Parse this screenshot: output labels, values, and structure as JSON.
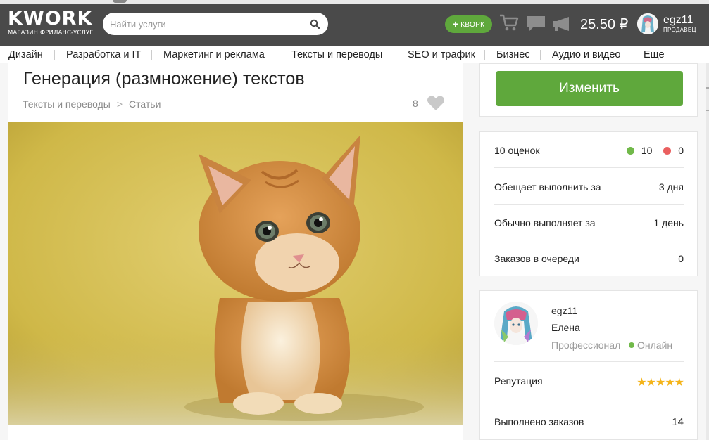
{
  "header": {
    "logo_word": "KWORK",
    "logo_tagline": "МАГАЗИН ФРИЛАНС-УСЛУГ",
    "search_placeholder": "Найти услуги",
    "add_button": "КВОРК",
    "balance": "25.50 ₽",
    "username": "egz11",
    "user_role": "ПРОДАВЕЦ",
    "accent_color": "#5fa83c"
  },
  "nav": {
    "items": [
      "Дизайн",
      "Разработка и IT",
      "Маркетинг и реклама",
      "Тексты и переводы",
      "SEO и трафик",
      "Бизнес",
      "Аудио и видео",
      "Еще"
    ]
  },
  "kwork": {
    "title": "Генерация (размножение) текстов",
    "breadcrumbs": [
      "Тексты и переводы",
      "Статьи"
    ],
    "likes": "8",
    "image": "orange-kitten-photo"
  },
  "sidebar": {
    "edit_button": "Изменить",
    "stats": {
      "reviews_label": "10 оценок",
      "positive": "10",
      "negative": "0",
      "promise_label": "Обещает выполнить за",
      "promise_value": "3 дня",
      "usual_label": "Обычно выполняет за",
      "usual_value": "1 день",
      "queue_label": "Заказов в очереди",
      "queue_value": "0"
    },
    "seller": {
      "login": "egz11",
      "name": "Елена",
      "level": "Профессионал",
      "status": "Онлайн",
      "reputation_label": "Репутация",
      "rating_stars": 5,
      "orders_label": "Выполнено заказов",
      "orders_value": "14"
    }
  }
}
